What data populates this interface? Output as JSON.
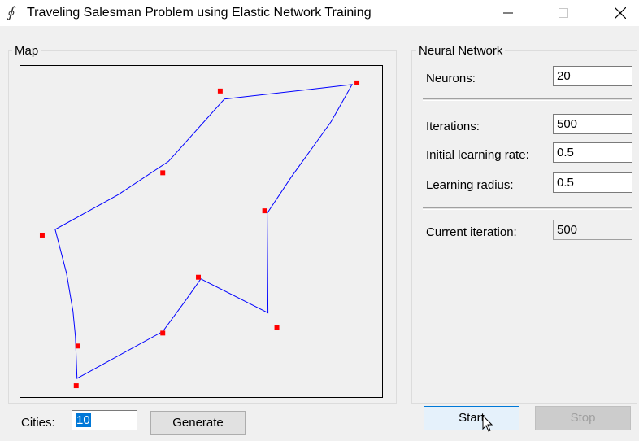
{
  "window": {
    "title": "Traveling Salesman Problem using Elastic Network Training",
    "icon": "function-icon"
  },
  "map_group": {
    "legend": "Map"
  },
  "map": {
    "city_color": "#ff0000",
    "route_color": "#0000ff",
    "cities": [
      [
        247,
        31
      ],
      [
        416,
        21
      ],
      [
        176,
        132
      ],
      [
        27,
        209
      ],
      [
        302,
        179
      ],
      [
        220,
        261
      ],
      [
        317,
        323
      ],
      [
        176,
        330
      ],
      [
        71,
        346
      ],
      [
        69,
        395
      ]
    ],
    "route": [
      [
        252,
        41
      ],
      [
        410,
        23
      ],
      [
        384,
        69
      ],
      [
        335,
        137
      ],
      [
        305,
        182
      ],
      [
        306,
        305
      ],
      [
        223,
        263
      ],
      [
        204,
        290
      ],
      [
        176,
        328
      ],
      [
        70,
        386
      ],
      [
        68,
        334
      ],
      [
        65,
        303
      ],
      [
        57,
        256
      ],
      [
        43,
        202
      ],
      [
        121,
        159
      ],
      [
        183,
        118
      ]
    ]
  },
  "cities_field": {
    "label": "Cities:",
    "value": "10"
  },
  "generate_button": {
    "label": "Generate"
  },
  "nn_group": {
    "legend": "Neural Network"
  },
  "neurons": {
    "label": "Neurons:",
    "value": "20"
  },
  "iterations": {
    "label": "Iterations:",
    "value": "500"
  },
  "learning_rate": {
    "label": "Initial learning rate:",
    "value": "0.5"
  },
  "learning_radius": {
    "label": "Learning radius:",
    "value": "0.5"
  },
  "current_iteration": {
    "label": "Current iteration:",
    "value": "500"
  },
  "start_button": {
    "label": "Start"
  },
  "stop_button": {
    "label": "Stop"
  }
}
